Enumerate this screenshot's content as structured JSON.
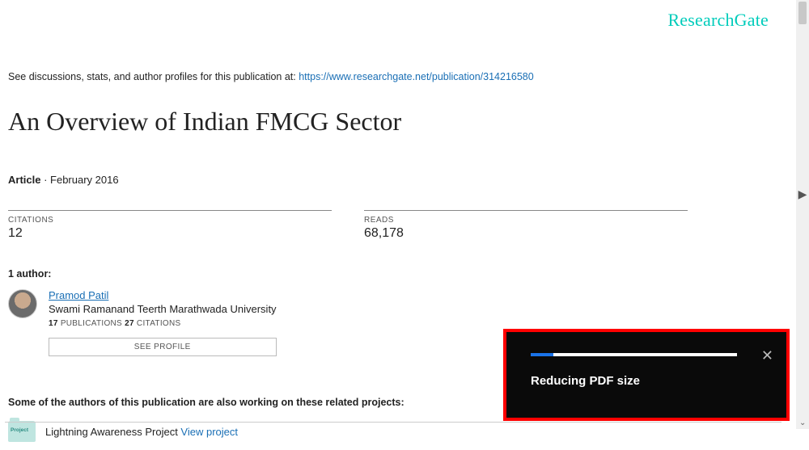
{
  "brand": "ResearchGate",
  "intro_prefix": "See discussions, stats, and author profiles for this publication at: ",
  "intro_link": "https://www.researchgate.net/publication/314216580",
  "title": "An Overview of Indian FMCG Sector",
  "type_label": "Article",
  "date_label": " · February 2016",
  "stats": {
    "citations_label": "CITATIONS",
    "citations_value": "12",
    "reads_label": "READS",
    "reads_value": "68,178"
  },
  "authors_heading": "1 author:",
  "author": {
    "name": "Pramod Patil",
    "affiliation": "Swami Ramanand Teerth Marathwada University",
    "pubs_n": "17",
    "pubs_label": " PUBLICATIONS   ",
    "cites_n": "27",
    "cites_label": " CITATIONS",
    "profile_btn": "SEE PROFILE"
  },
  "related_heading": "Some of the authors of this publication are also working on these related projects:",
  "project": {
    "icon_label": "Project",
    "name": "Lightning Awareness Project ",
    "view_label": "View project"
  },
  "toast": {
    "message": "Reducing PDF size",
    "progress_percent": 11
  }
}
